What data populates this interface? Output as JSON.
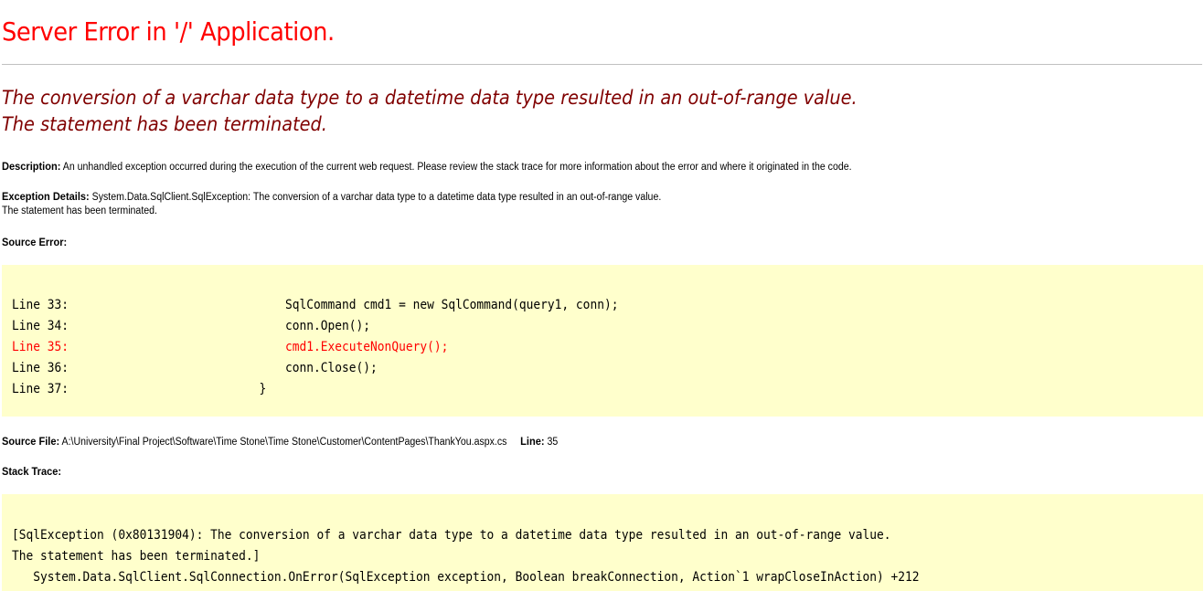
{
  "page": {
    "title": "Server Error in '/' Application.",
    "heading_line1": "The conversion of a varchar data type to a datetime data type resulted in an out-of-range value.",
    "heading_line2": "The statement has been terminated."
  },
  "description": {
    "label": "Description:",
    "text": " An unhandled exception occurred during the execution of the current web request. Please review the stack trace for more information about the error and where it originated in the code."
  },
  "exception_details": {
    "label": "Exception Details:",
    "text_line1": " System.Data.SqlClient.SqlException: The conversion of a varchar data type to a datetime data type resulted in an out-of-range value.",
    "text_line2": "The statement has been terminated."
  },
  "source_error": {
    "label": "Source Error:",
    "lines": [
      {
        "label": "Line 33:",
        "code": "SqlCommand cmd1 = new SqlCommand(query1, conn);"
      },
      {
        "label": "Line 34:",
        "code": "conn.Open();"
      },
      {
        "label": "Line 35:",
        "code": "cmd1.ExecuteNonQuery();"
      },
      {
        "label": "Line 36:",
        "code": "conn.Close();"
      },
      {
        "label": "Line 37:",
        "code": "}"
      }
    ]
  },
  "source_file": {
    "label": "Source File:",
    "path": " A:\\University\\Final Project\\Software\\Time Stone\\Time Stone\\Customer\\ContentPages\\ThankYou.aspx.cs",
    "line_label": "Line:",
    "line_value": " 35"
  },
  "stack_trace": {
    "label": "Stack Trace:",
    "lines": [
      "[SqlException (0x80131904): The conversion of a varchar data type to a datetime data type resulted in an out-of-range value.",
      "The statement has been terminated.]",
      "   System.Data.SqlClient.SqlConnection.OnError(SqlException exception, Boolean breakConnection, Action`1 wrapCloseInAction) +212"
    ]
  },
  "colors": {
    "title": "#ff0000",
    "heading": "#800000",
    "code_background": "#ffffcc",
    "error_line": "#ff0000"
  }
}
